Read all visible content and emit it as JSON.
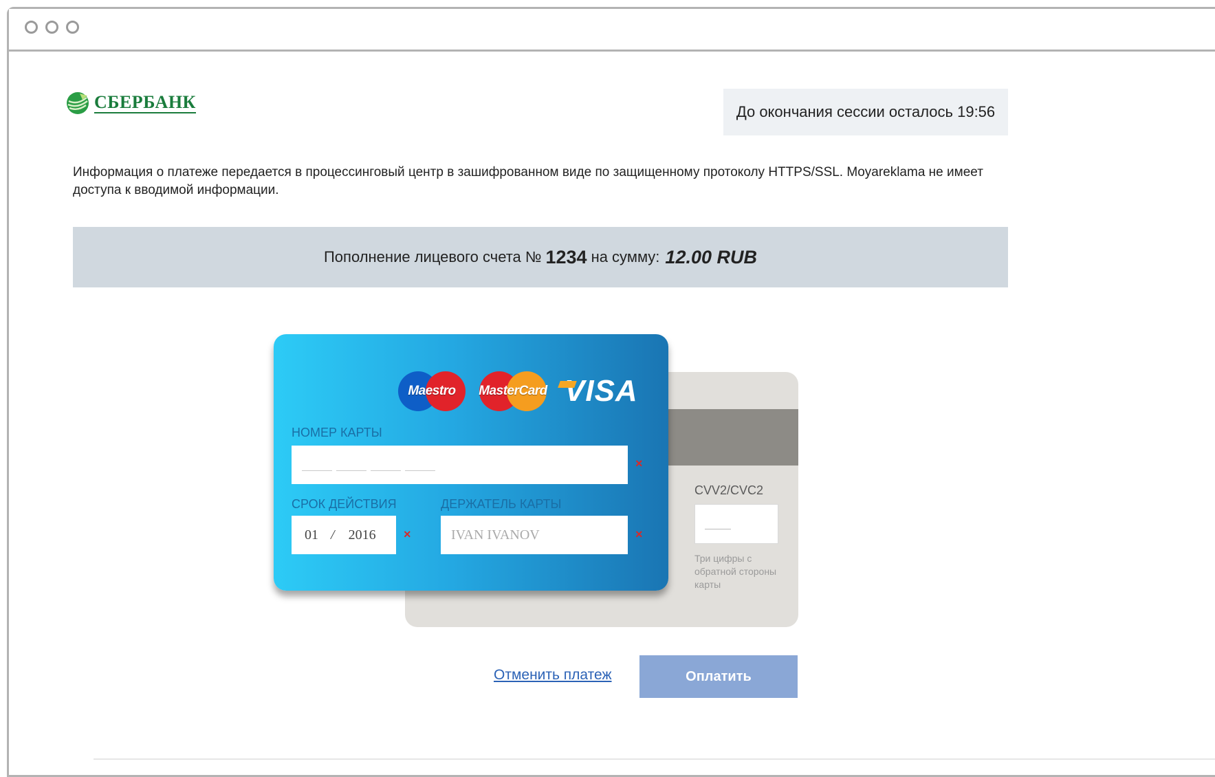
{
  "bank": {
    "name": "СБЕРБАНК",
    "logo_icon": "sberbank-leaf-icon",
    "brand_color": "#1a7c3c"
  },
  "session": {
    "text": "До окончания сессии осталось 19:56"
  },
  "info": {
    "text": "Информация о платеже передается в процессинговый центр в зашифрованном виде по защищенному протоколу HTTPS/SSL. Moyareklama не имеет доступа к вводимой информации."
  },
  "payment": {
    "prefix": "Пополнение лицевого счета №",
    "account_number": "1234",
    "middle": "на сумму:",
    "amount": "12.00 RUB"
  },
  "card": {
    "brands": [
      "Maestro",
      "MasterCard",
      "VISA"
    ],
    "number_label": "НОМЕР КАРТЫ",
    "expiry_label": "СРОК ДЕЙСТВИЯ",
    "expiry_month": "01",
    "expiry_sep": "/",
    "expiry_year": "2016",
    "holder_label": "ДЕРЖАТЕЛЬ КАРТЫ",
    "holder_placeholder": "IVAN IVANOV",
    "required_mark": "×",
    "cvv_label": "CVV2/CVC2",
    "cvv_hint": "Три цифры с обратной стороны карты"
  },
  "actions": {
    "cancel_label": "Отменить платеж",
    "pay_label": "Оплатить"
  },
  "colors": {
    "accent": "#2b62b6",
    "pay_button": "#8aa7d6",
    "payment_bar": "#d0d8df",
    "required": "#d62a2a"
  }
}
